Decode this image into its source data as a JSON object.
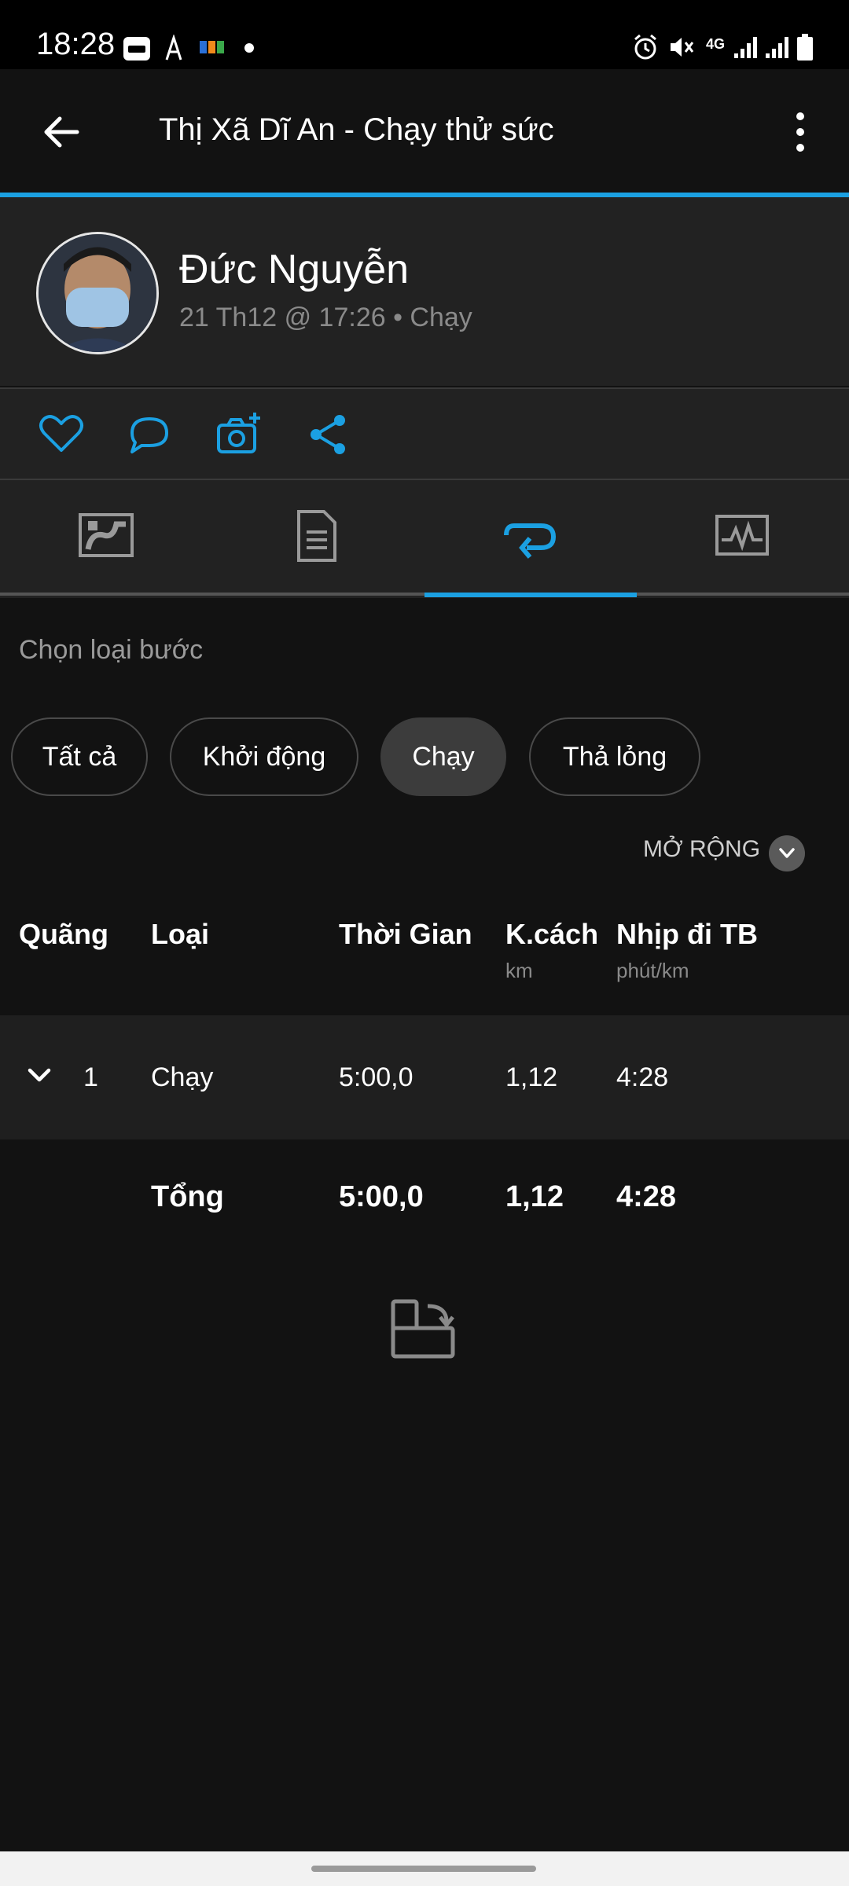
{
  "status_bar": {
    "time": "18:28",
    "app_icons": [
      "zalo-icon",
      "strava-icon",
      "fpt-icon",
      "dot-icon"
    ],
    "system_icons": [
      "alarm-icon",
      "mute-icon",
      "4g-icon",
      "signal-icon",
      "signal-icon",
      "battery-icon"
    ],
    "network_label": "4G"
  },
  "app_bar": {
    "title": "Thị Xã Dĩ An - Chạy thử sức",
    "back_icon": "arrow-left-icon",
    "menu_icon": "more-vertical-icon"
  },
  "profile": {
    "name": "Đức Nguyễn",
    "meta": "21 Th12 @ 17:26 • Chạy"
  },
  "actions": [
    "heart-icon",
    "comment-icon",
    "camera-plus-icon",
    "share-icon"
  ],
  "tabs": [
    {
      "icon": "map-icon",
      "active": false
    },
    {
      "icon": "document-icon",
      "active": false
    },
    {
      "icon": "laps-icon",
      "active": true
    },
    {
      "icon": "chart-icon",
      "active": false
    }
  ],
  "filter": {
    "label": "Chọn loại bước",
    "chips": [
      "Tất cả",
      "Khởi động",
      "Chạy",
      "Thả lỏng"
    ],
    "selected": "Chạy"
  },
  "expand_label": "MỞ RỘNG",
  "table": {
    "headers": {
      "lap": "Quãng",
      "type": "Loại",
      "time": "Thời Gian",
      "distance": "K.cách",
      "distance_unit": "km",
      "pace": "Nhịp đi TB",
      "pace_unit": "phút/km"
    },
    "rows": [
      {
        "lap": "1",
        "type": "Chạy",
        "time": "5:00,0",
        "distance": "1,12",
        "pace": "4:28"
      }
    ],
    "total": {
      "label": "Tổng",
      "time": "5:00,0",
      "distance": "1,12",
      "pace": "4:28"
    }
  },
  "colors": {
    "accent": "#1ba0e2",
    "background": "#121212",
    "surface": "#222222"
  }
}
